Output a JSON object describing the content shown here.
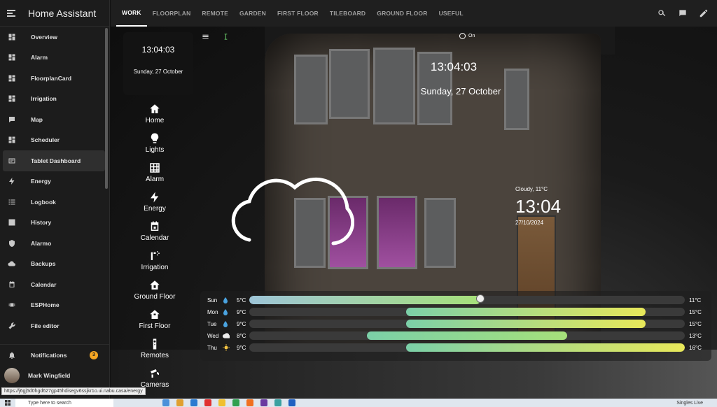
{
  "app": {
    "title": "Home Assistant"
  },
  "sidebar": {
    "items": [
      {
        "label": "Overview",
        "icon": "dashboard-icon"
      },
      {
        "label": "Alarm",
        "icon": "dashboard-icon"
      },
      {
        "label": "FloorplanCard",
        "icon": "dashboard-icon"
      },
      {
        "label": "Irrigation",
        "icon": "dashboard-icon"
      },
      {
        "label": "Map",
        "icon": "map-icon"
      },
      {
        "label": "Scheduler",
        "icon": "dashboard-icon"
      },
      {
        "label": "Tablet Dashboard",
        "icon": "tablet-icon",
        "active": true
      },
      {
        "label": "Energy",
        "icon": "lightning-icon"
      },
      {
        "label": "Logbook",
        "icon": "list-icon"
      },
      {
        "label": "History",
        "icon": "chart-icon"
      },
      {
        "label": "Alarmo",
        "icon": "shield-icon"
      },
      {
        "label": "Backups",
        "icon": "cloud-icon"
      },
      {
        "label": "Calendar",
        "icon": "calendar-icon"
      },
      {
        "label": "ESPHome",
        "icon": "chip-icon"
      },
      {
        "label": "File editor",
        "icon": "wrench-icon"
      }
    ],
    "notifications": {
      "label": "Notifications",
      "count": "3"
    },
    "user": {
      "label": "Mark Wingfield"
    }
  },
  "topbar": {
    "tabs": [
      "WORK",
      "FLOORPLAN",
      "REMOTE",
      "GARDEN",
      "FIRST FLOOR",
      "TILEBOARD",
      "GROUND FLOOR",
      "USEFUL"
    ],
    "active_tab": "WORK"
  },
  "dashboard": {
    "time": "13:04:03",
    "date": "Sunday, 27 October",
    "nav": [
      "Home",
      "Lights",
      "Alarm",
      "Energy",
      "Calendar",
      "Irrigation",
      "Ground Floor",
      "First Floor",
      "Remotes",
      "Cameras"
    ],
    "toggle_label": "On",
    "center_time": "13:04:03",
    "center_date": "Sunday, 27 October",
    "weather_summary": "Cloudy, 11°C",
    "clock": "13:04",
    "date_numeric": "27/10/2024"
  },
  "forecast": [
    {
      "day": "Sun",
      "icon": "raindrop-icon",
      "low": "5°C",
      "high": "11°C",
      "start": 0.0,
      "end": 0.53,
      "knob": 0.53,
      "color": "#9ec5d8"
    },
    {
      "day": "Mon",
      "icon": "raindrop-icon",
      "low": "9°C",
      "high": "15°C",
      "start": 0.36,
      "end": 0.91,
      "color": "#7bd0a8"
    },
    {
      "day": "Tue",
      "icon": "raindrop-icon",
      "low": "9°C",
      "high": "15°C",
      "start": 0.36,
      "end": 0.91,
      "color": "#7bd0a8"
    },
    {
      "day": "Wed",
      "icon": "cloud-icon",
      "low": "8°C",
      "high": "13°C",
      "start": 0.27,
      "end": 0.73,
      "color": "#7bd0a8"
    },
    {
      "day": "Thu",
      "icon": "sun-icon",
      "low": "9°C",
      "high": "16°C",
      "start": 0.36,
      "end": 1.0,
      "color": "#7bd0a8"
    }
  ],
  "status_url": "https://j6gj5d0hgd627gp45hdisegv6ssjkr1o.ui.nabu.casa/energy",
  "taskbar": {
    "search_placeholder": "Type here to search",
    "right_label": "Singles Live"
  },
  "colors": {
    "accent_bar_start": "#7bd0a8",
    "accent_bar_end": "#e8e85a",
    "badge": "#f5a623"
  }
}
